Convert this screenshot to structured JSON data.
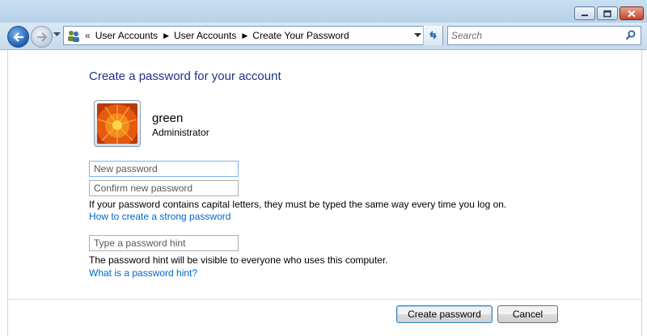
{
  "window": {
    "controls": {
      "minimize": "minimize-icon",
      "maximize": "maximize-icon",
      "close": "close-icon"
    }
  },
  "navbar": {
    "address": {
      "overflow": "«",
      "crumbs": [
        {
          "label": "User Accounts"
        },
        {
          "label": "User Accounts"
        },
        {
          "label": "Create Your Password"
        }
      ]
    },
    "search": {
      "placeholder": "Search"
    }
  },
  "page": {
    "title": "Create a password for your account",
    "user": {
      "name": "green",
      "role": "Administrator"
    },
    "fields": {
      "new_password_placeholder": "New password",
      "confirm_password_placeholder": "Confirm new password",
      "hint_placeholder": "Type a password hint"
    },
    "caps_note": "If your password contains capital letters, they must be typed the same way every time you log on.",
    "strong_password_link": "How to create a strong password",
    "hint_note": "The password hint will be visible to everyone who uses this computer.",
    "hint_link": "What is a password hint?",
    "buttons": {
      "create": "Create password",
      "cancel": "Cancel"
    }
  },
  "colors": {
    "title": "#1e3287",
    "link": "#0066cc",
    "focus_border": "#7eb4ea"
  }
}
